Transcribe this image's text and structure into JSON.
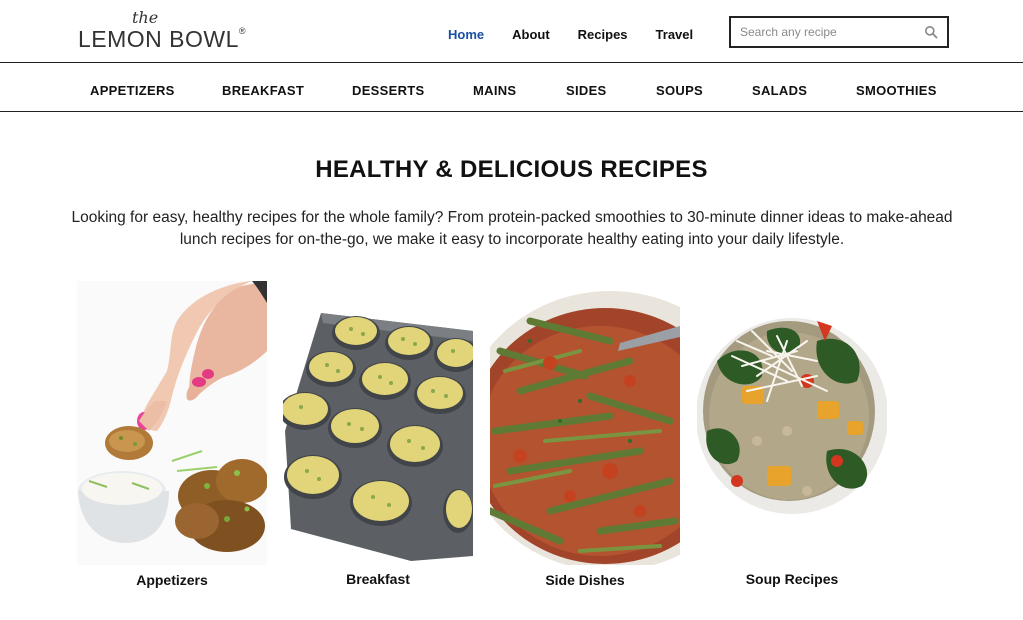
{
  "logo": {
    "the": "the",
    "name": "LEMON BOWL",
    "reg": "®"
  },
  "topnav": [
    {
      "label": "Home",
      "active": true
    },
    {
      "label": "About"
    },
    {
      "label": "Recipes"
    },
    {
      "label": "Travel"
    }
  ],
  "search": {
    "placeholder": "Search any recipe",
    "icon": "search-icon"
  },
  "categories": [
    "APPETIZERS",
    "BREAKFAST",
    "DESSERTS",
    "MAINS",
    "SIDES",
    "SOUPS",
    "SALADS",
    "SMOOTHIES"
  ],
  "main": {
    "title": "HEALTHY & DELICIOUS RECIPES",
    "intro": "Looking for easy, healthy recipes for the whole family? From protein-packed smoothies to 30-minute dinner ideas to make-ahead lunch recipes for on-the-go, we make it easy to incorporate healthy eating into your daily lifestyle."
  },
  "cards": [
    {
      "label": "Appetizers"
    },
    {
      "label": "Breakfast"
    },
    {
      "label": "Side Dishes"
    },
    {
      "label": "Soup Recipes"
    }
  ],
  "colors": {
    "active_link": "#1b4fa0",
    "border": "#222222",
    "text": "#111111"
  }
}
